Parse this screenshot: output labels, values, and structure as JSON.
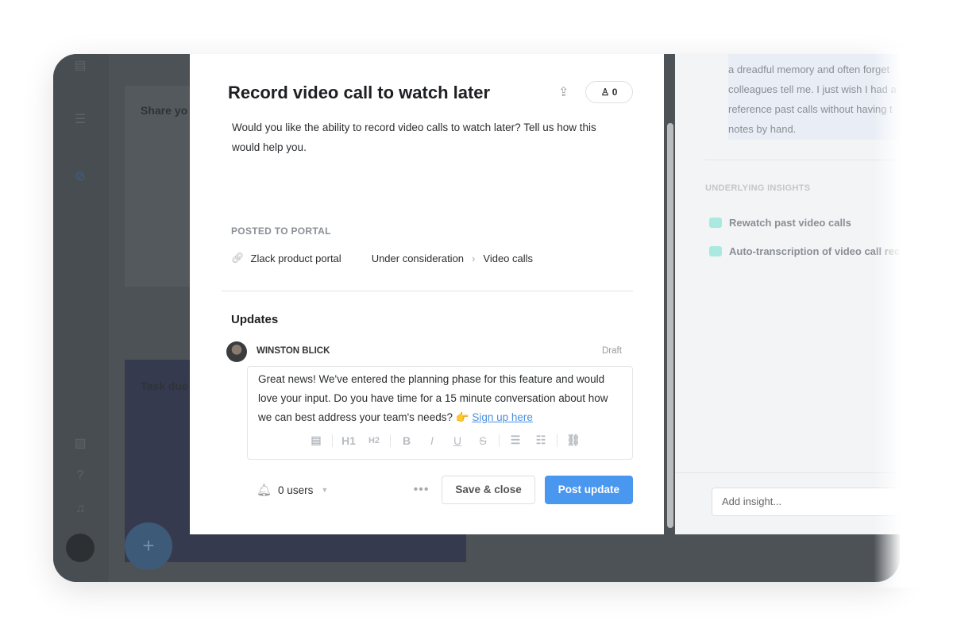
{
  "background": {
    "cards": [
      "Share yo",
      "Task due"
    ]
  },
  "modal": {
    "title": "Record video call to watch later",
    "vote_count": "0",
    "description": "Would you like the ability to record video calls to watch later? Tell us how this would help you.",
    "posted_label": "POSTED TO PORTAL",
    "portal_name": "Zlack product portal",
    "status": "Under consideration",
    "category": "Video calls",
    "updates_title": "Updates",
    "author": "WINSTON BLICK",
    "draft_label": "Draft",
    "editor_text": "Great news! We've entered the planning phase for this feature and would love your input. Do you have time for a 15 minute conversation about how we can best address your team's needs?",
    "emoji": "👉",
    "link_text": "Sign up here",
    "toolbar": [
      "H1",
      "H2",
      "B",
      "I",
      "U",
      "S"
    ],
    "notify_users": "0 users",
    "save_label": "Save & close",
    "post_label": "Post update"
  },
  "right_panel": {
    "quote_lines": [
      "a dreadful memory and often forget",
      "colleagues tell me. I just wish I had a",
      "reference past calls without having t",
      "notes by hand."
    ],
    "insights_label": "UNDERLYING INSIGHTS",
    "insights": [
      "Rewatch past video calls",
      "Auto-transcription of video call recordings"
    ],
    "add_placeholder": "Add insight...",
    "insight_color": "#a9e9e0"
  },
  "colors": {
    "accent": "#4a97f0",
    "link": "#4a90e2"
  }
}
